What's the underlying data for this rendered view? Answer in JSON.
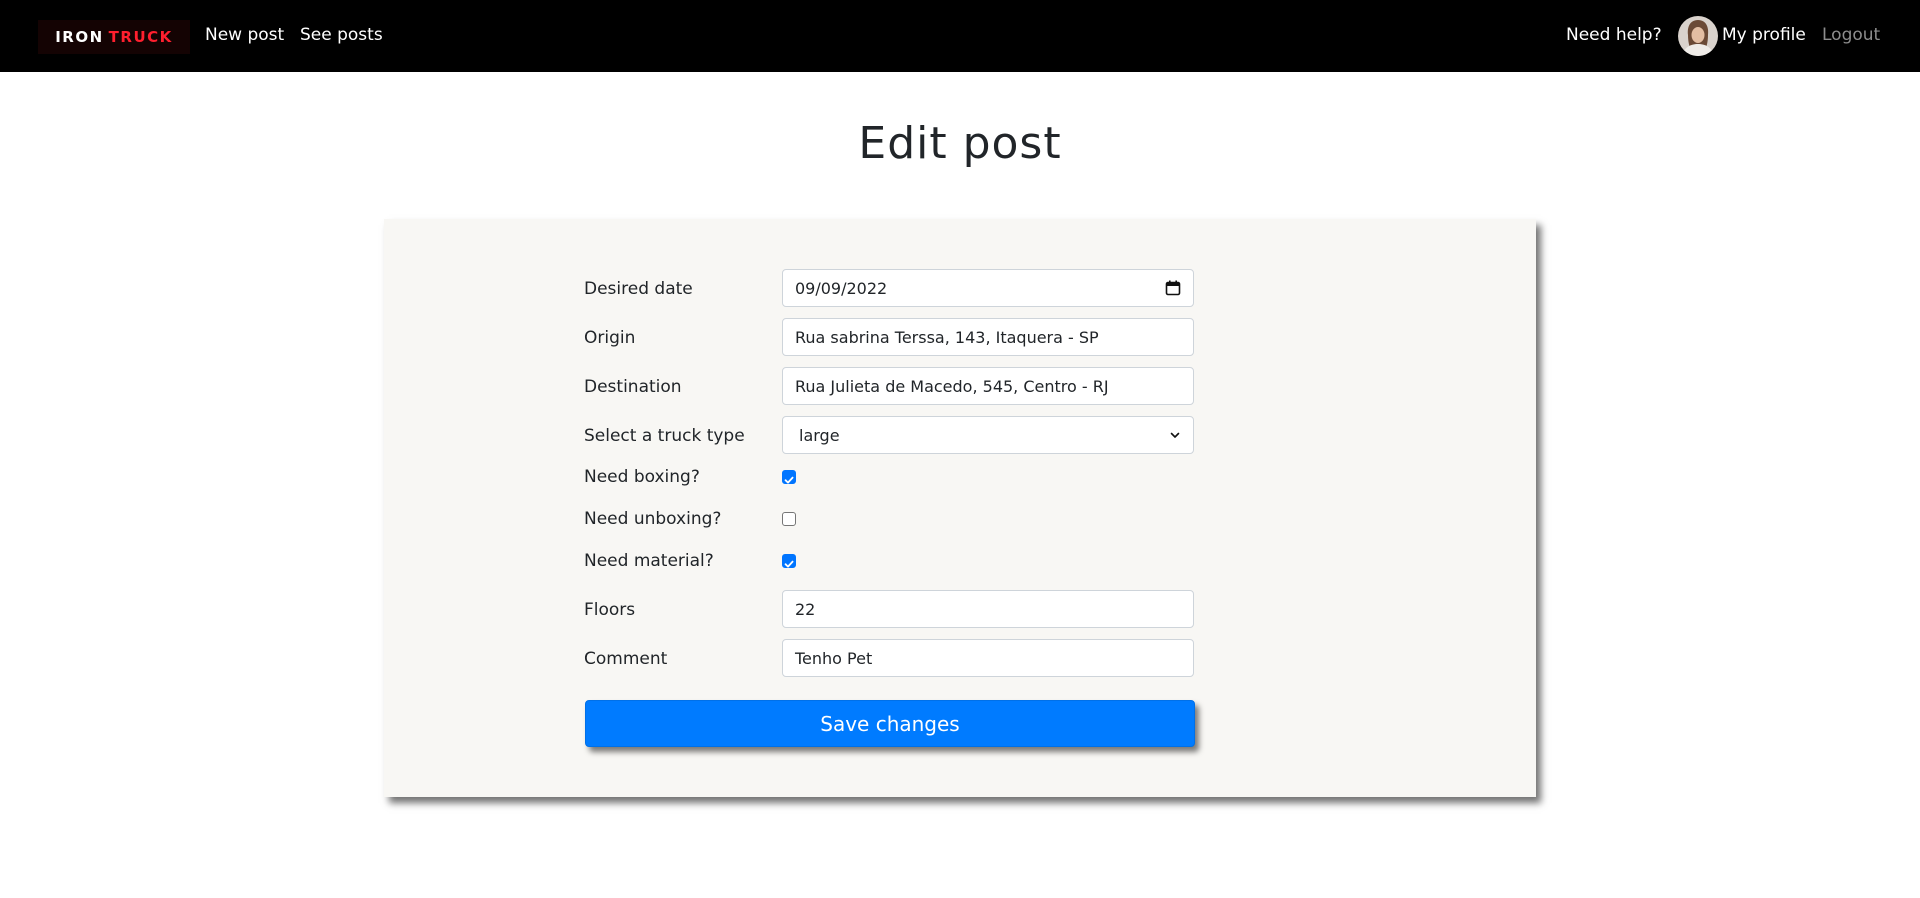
{
  "navbar": {
    "brand": {
      "word1": "IRON",
      "word2": "TRUCK"
    },
    "links": {
      "new_post": "New post",
      "see_posts": "See posts",
      "need_help": "Need help?",
      "my_profile": "My profile",
      "logout": "Logout"
    }
  },
  "page": {
    "title": "Edit post"
  },
  "form": {
    "desired_date": {
      "label": "Desired date",
      "value": "09/09/2022"
    },
    "origin": {
      "label": "Origin",
      "value": "Rua sabrina Terssa, 143, Itaquera - SP"
    },
    "destination": {
      "label": "Destination",
      "value": "Rua Julieta de Macedo, 545, Centro - RJ"
    },
    "truck_type": {
      "label": "Select a truck type",
      "value": "large"
    },
    "need_boxing": {
      "label": "Need boxing?",
      "checked": true
    },
    "need_unboxing": {
      "label": "Need unboxing?",
      "checked": false
    },
    "need_material": {
      "label": "Need material?",
      "checked": true
    },
    "floors": {
      "label": "Floors",
      "value": "22"
    },
    "comment": {
      "label": "Comment",
      "value": "Tenho Pet"
    },
    "save_label": "Save changes"
  },
  "colors": {
    "navbar_bg": "#000000",
    "brand_accent": "#ff1f2e",
    "card_bg": "#f8f7f4",
    "primary": "#007bff",
    "checkbox_on": "#0075ff"
  },
  "icons": {
    "date": "calendar-icon",
    "select": "chevron-down-icon"
  }
}
